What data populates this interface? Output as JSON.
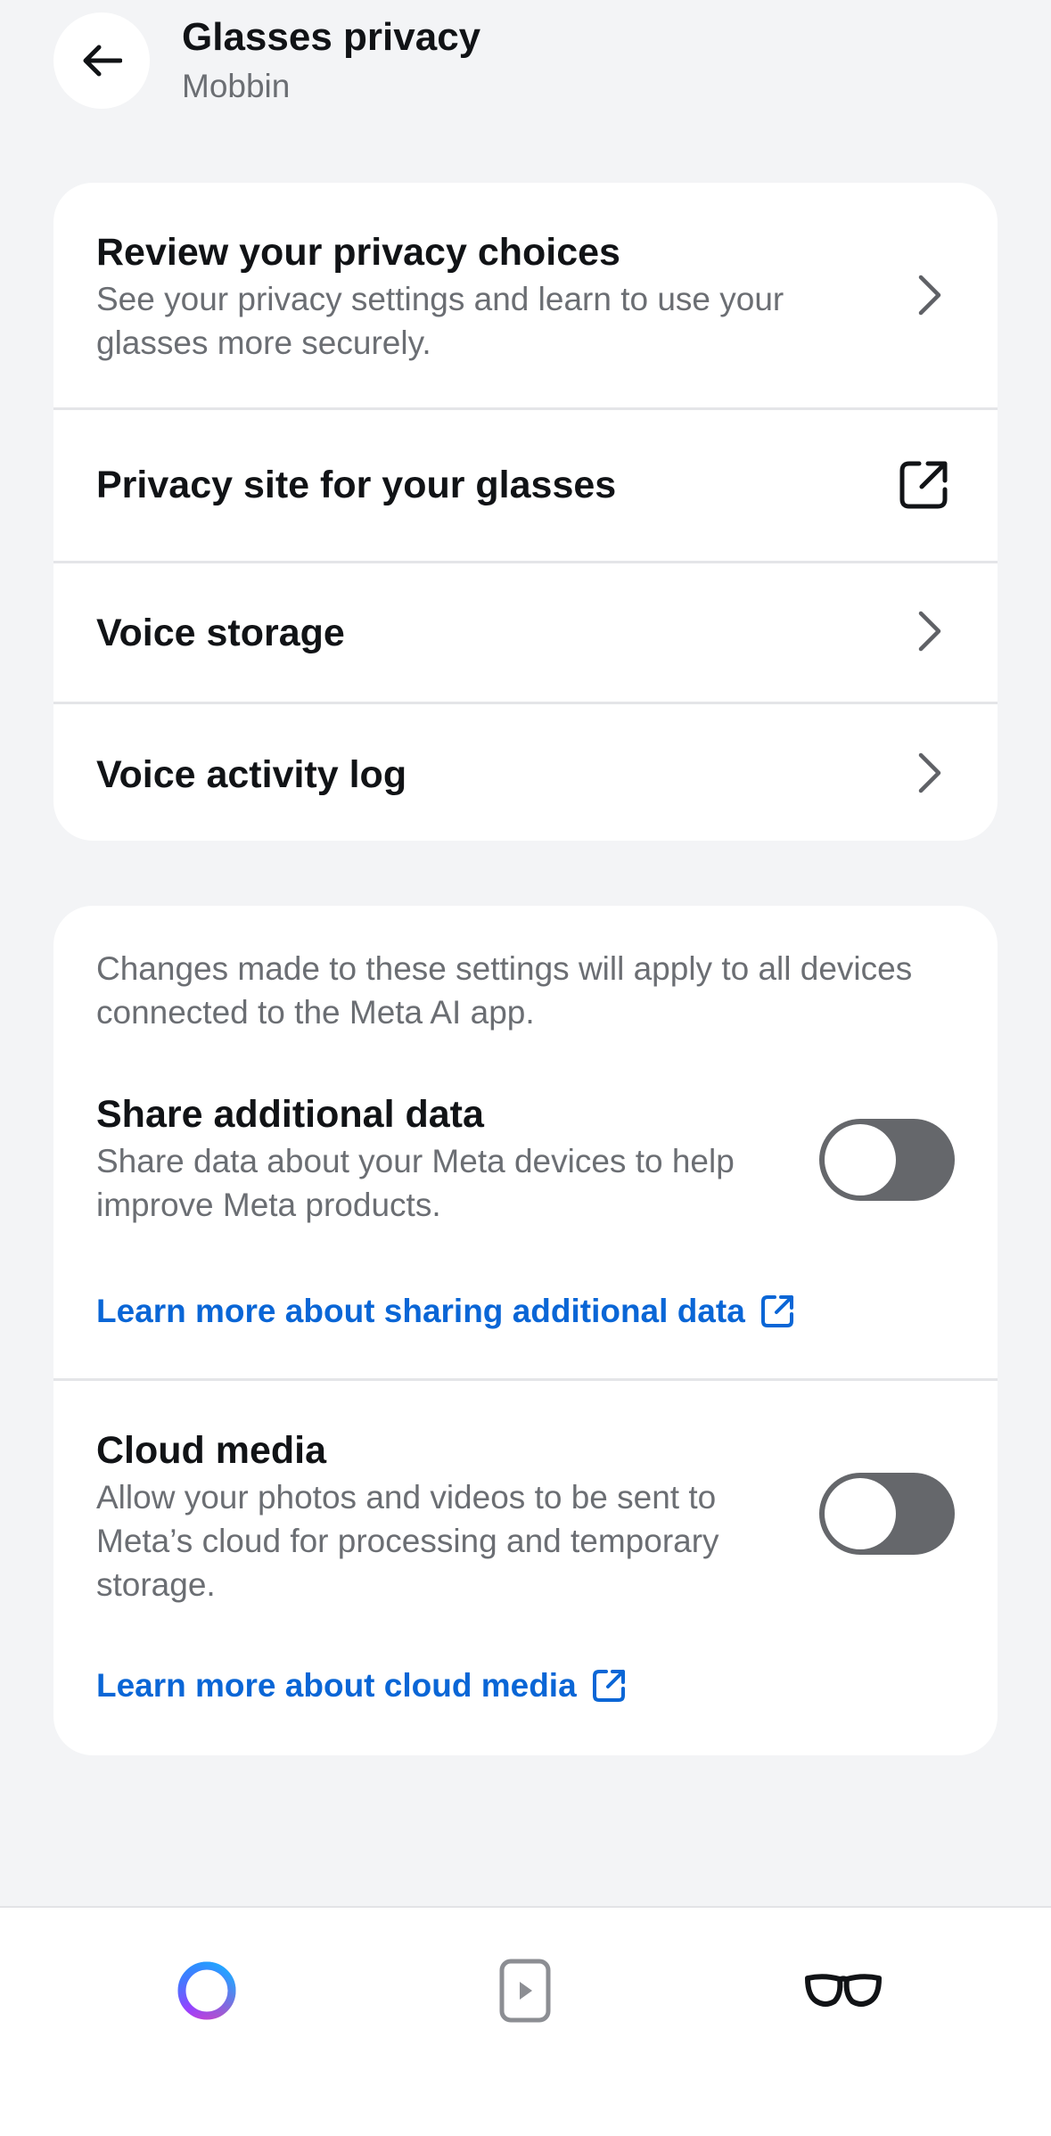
{
  "header": {
    "title": "Glasses privacy",
    "subtitle": "Mobbin",
    "back_icon": "arrow-left-icon"
  },
  "privacy_card": {
    "items": [
      {
        "title": "Review your privacy choices",
        "description": "See your privacy settings and learn to use your glasses more securely.",
        "icon": "chevron-right-icon"
      },
      {
        "title": "Privacy site for your glasses",
        "icon": "external-link-icon"
      },
      {
        "title": "Voice storage",
        "icon": "chevron-right-icon"
      },
      {
        "title": "Voice activity log",
        "icon": "chevron-right-icon"
      }
    ]
  },
  "settings_card": {
    "note": "Changes made to these settings will apply to all devices connected to the Meta AI app.",
    "share_data": {
      "title": "Share additional data",
      "description": "Share data about your Meta devices to help improve Meta products.",
      "enabled": false,
      "link": "Learn more about sharing additional data"
    },
    "cloud_media": {
      "title": "Cloud media",
      "description": "Allow your photos and videos to be sent to Meta’s cloud for processing and temporary storage.",
      "enabled": false,
      "link": "Learn more about cloud media"
    }
  },
  "bottom_nav": {
    "items": [
      {
        "icon": "meta-ai-ring-icon"
      },
      {
        "icon": "play-video-icon"
      },
      {
        "icon": "glasses-icon",
        "active": true
      }
    ]
  },
  "colors": {
    "background": "#f3f4f6",
    "card": "#ffffff",
    "link": "#0a66d6",
    "toggle_off": "#65676b",
    "secondary_text": "#6b6e73"
  }
}
